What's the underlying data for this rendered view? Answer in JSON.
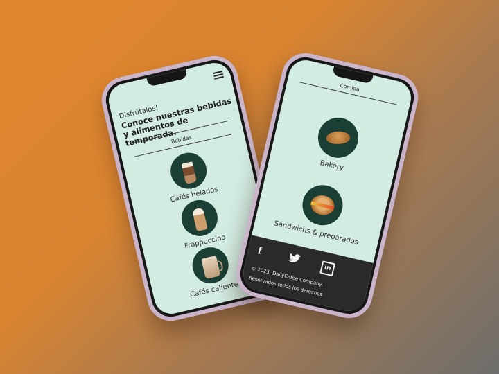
{
  "left_screen": {
    "greeting": "Disfrútalos!",
    "headline": "Conoce nuestras bebidas y alimentos de temporada.",
    "section_label": "Bebidas",
    "items": [
      {
        "label": "Cafés helados",
        "icon": "iced-coffee-icon"
      },
      {
        "label": "Frappuccino",
        "icon": "frappuccino-icon"
      },
      {
        "label": "Cafés calientes",
        "icon": "hot-coffee-icon"
      }
    ]
  },
  "right_screen": {
    "section_label": "Comida",
    "items": [
      {
        "label": "Bakery",
        "icon": "croissant-icon"
      },
      {
        "label": "Sándwichs & preparados",
        "icon": "bagel-sandwich-icon"
      }
    ],
    "footer": {
      "social": [
        {
          "name": "facebook-icon",
          "glyph": "f"
        },
        {
          "name": "twitter-icon",
          "glyph": "🐦"
        },
        {
          "name": "linkedin-icon",
          "glyph": "in"
        }
      ],
      "copyright_line1": "© 2023, DailyCafee Company.",
      "copyright_line2": "Reservados todos los derechos"
    }
  },
  "colors": {
    "screen_bg": "#d3ece2",
    "circle_bg": "#1c3f35",
    "footer_bg": "#2a2a2a",
    "phone_frame": "#c9b4c9"
  }
}
